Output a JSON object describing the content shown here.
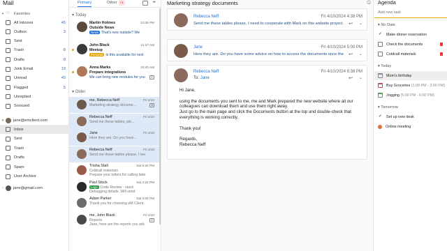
{
  "app_title": "Mail",
  "sidebar": {
    "favorites_label": "Favorites",
    "favorites": [
      {
        "label": "All Inboxes",
        "count": "45"
      },
      {
        "label": "Outbox",
        "count": "3"
      },
      {
        "label": "Sent",
        "count": ""
      },
      {
        "label": "Trash",
        "count": "8"
      },
      {
        "label": "Drafts",
        "count": "8"
      },
      {
        "label": "Junk Email",
        "count": "19"
      },
      {
        "label": "Unread",
        "count": "45"
      },
      {
        "label": "Flagged",
        "count": "5"
      },
      {
        "label": "Unreplied",
        "count": ""
      },
      {
        "label": "Snoozed",
        "count": ""
      }
    ],
    "account1": "jane@emclient.com",
    "account1_folders": [
      {
        "label": "Inbox",
        "count": ""
      },
      {
        "label": "Sent",
        "count": ""
      },
      {
        "label": "Trash",
        "count": ""
      },
      {
        "label": "Drafts",
        "count": ""
      },
      {
        "label": "Spam",
        "count": ""
      },
      {
        "label": "User Archive",
        "count": ""
      }
    ],
    "account2": "jane@gmail.com"
  },
  "list": {
    "tab_primary": "Primary",
    "tab_other": "Other",
    "other_badge": "+1",
    "section_today": "Today",
    "section_older": "Older",
    "today": [
      {
        "from": "Martin Holmes",
        "date": "12:05 PM",
        "subject": "Outside News",
        "preview": "That's new outside? We",
        "tag": "News",
        "tag_color": "#1e6fd9",
        "count": "",
        "avatar": "#5a4a3a",
        "dot": false
      },
      {
        "from": "John Black",
        "date": "11:27 AM",
        "subject": "Meetup",
        "preview": "Is this available for next",
        "tag": "Personal",
        "tag_color": "#e8a000",
        "count": "",
        "avatar": "#3a3a3a",
        "dot": true
      },
      {
        "from": "Anna Marks",
        "date": "10:40 AM",
        "subject": "Prepare integrations",
        "preview": "We can bring new modules for you",
        "tag": "",
        "tag_color": "",
        "count": "2",
        "avatar": "#b07a5a",
        "dot": true
      }
    ],
    "older": [
      {
        "from": "me, Rebecca Neff",
        "date": "Fri 4/10",
        "subject": "",
        "preview": "Marketing strategy docume...",
        "count": "3",
        "avatar": "#6a5a4a",
        "sel": true
      },
      {
        "from": "Rebecca Neff",
        "date": "Fri 4/10",
        "subject": "",
        "preview": "Send me these tables, ple...",
        "count": "",
        "avatar": "#8a6a5a",
        "sel": true
      },
      {
        "from": "Jane",
        "date": "Fri 4/10",
        "subject": "",
        "preview": "Here they are. Do you have...",
        "count": "",
        "avatar": "#7a5a4a",
        "sel": true
      },
      {
        "from": "Rebecca Neff",
        "date": "Fri 4/10",
        "subject": "",
        "preview": "Send me these tables please. I need",
        "count": "",
        "avatar": "#8a6a5a",
        "sel": true
      },
      {
        "from": "Trisha Stall",
        "date": "Sat 5:20 PM",
        "subject": "",
        "preview": "Coldcall materials",
        "preview2": "Prepare your letters for calling later t",
        "count": "",
        "avatar": "#9a5a4a",
        "sel": false
      },
      {
        "from": "Paul Stock",
        "date": "Sat 4:15 PM",
        "subject": "",
        "preview": "Code Review - stack",
        "preview2": "Debugging details. Will send",
        "tag": "Logs",
        "tag_color": "#2a9a4a",
        "count": "",
        "avatar": "#2a2a2a",
        "sel": false
      },
      {
        "from": "Adam Parker",
        "date": "Sat 4:05 PM",
        "subject": "",
        "preview": "Thank you for choosing eM Client.",
        "count": "",
        "avatar": "#6a6a6a",
        "sel": false
      },
      {
        "from": "me, John Black",
        "date": "Fri 4/10",
        "subject": "",
        "preview": "Reports",
        "preview2": "Jane, here are the reports you ask",
        "count": "2",
        "avatar": "#4a4a4a",
        "sel": false
      }
    ]
  },
  "reader": {
    "title": "Marketing strategy documents",
    "messages": [
      {
        "from": "Rebecca Neff",
        "date": "Fri 4/10/2024 4:38 PM",
        "preview": "Send me these tables please, I need to cooperate with Mark on this website project..."
      },
      {
        "from": "Jane",
        "date": "Fri 4/10/2024 5:00 PM",
        "preview": "Here they are. Do you have some advice on how to access the documents once they..."
      },
      {
        "from": "Rebecca Neff",
        "date": "Fri 4/10/2024 6:38 PM",
        "to_label": "To:",
        "to": "Jane",
        "body": [
          "Hi Jane,",
          "",
          "using the documents you sent to me, me and Mark prepared the new website where all our",
          "colleagues can download them and use them right away.",
          "Just go to the main page and click the Documents button at the top and double-check that",
          "everything is working correctly.",
          "",
          "Thank you!",
          "",
          "Regards,",
          "Rebecca Neff"
        ]
      }
    ]
  },
  "agenda": {
    "title": "Agenda",
    "placeholder": "Add new task",
    "no_date_label": "No Date",
    "no_date": [
      {
        "label": "Make dinner reservation",
        "done": true,
        "flag": false
      },
      {
        "label": "Check the documents",
        "done": false,
        "flag": true
      },
      {
        "label": "Coldcall materials",
        "done": false,
        "flag": true
      }
    ],
    "today_label": "Today",
    "today": [
      {
        "label": "Mom's birthday",
        "time": "",
        "color": "#7a8a9a"
      },
      {
        "label": "Buy Groceries",
        "time": "(1:00 PM - 2:00 PM)",
        "color": "#c05050"
      },
      {
        "label": "Jogging",
        "time": "(5:00 PM - 6:00 PM)",
        "color": "#50a050"
      }
    ],
    "tomorrow_label": "Tomorrow",
    "tomorrow": [
      {
        "label": "Set up new desk",
        "time": "",
        "color": "#555"
      },
      {
        "label": "Online meeting",
        "time": "",
        "color": "#e07040"
      }
    ]
  }
}
